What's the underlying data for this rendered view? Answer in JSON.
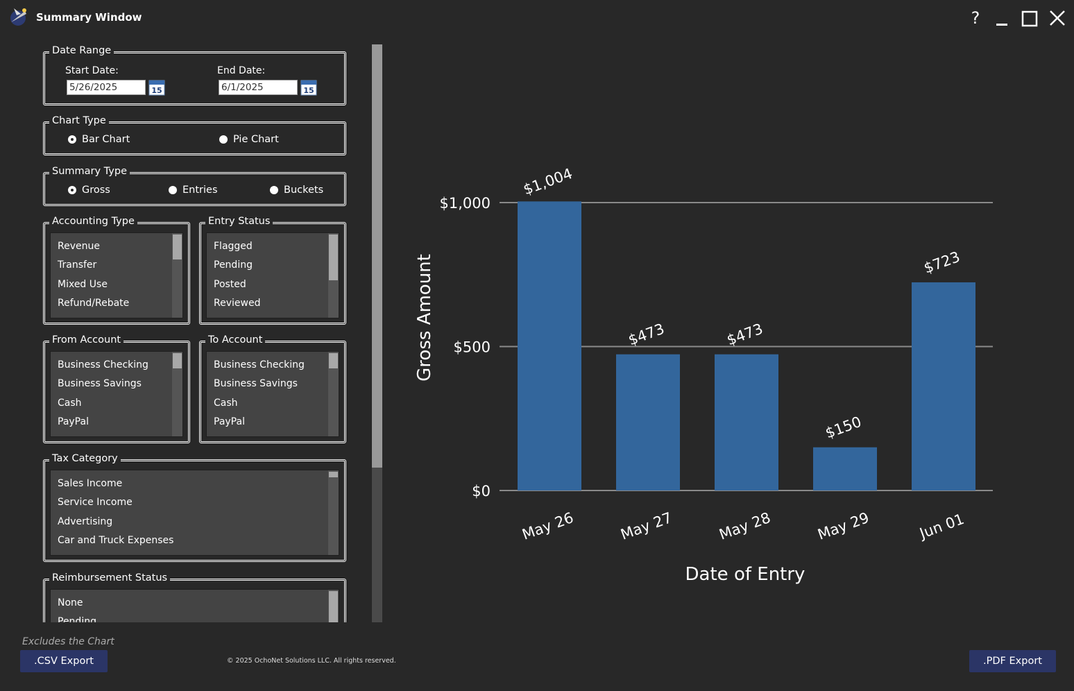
{
  "window": {
    "title": "Summary Window",
    "help_label": "?"
  },
  "date_range": {
    "legend": "Date Range",
    "start_label": "Start Date:",
    "start_value": "5/26/2025",
    "end_label": "End Date:",
    "end_value": "6/1/2025",
    "calendar_day": "15"
  },
  "chart_type": {
    "legend": "Chart Type",
    "options": [
      "Bar Chart",
      "Pie Chart"
    ],
    "selected": "Bar Chart"
  },
  "summary_type": {
    "legend": "Summary Type",
    "options": [
      "Gross",
      "Entries",
      "Buckets"
    ],
    "selected": "Gross"
  },
  "accounting_type": {
    "legend": "Accounting Type",
    "items": [
      "Revenue",
      "Transfer",
      "Mixed Use",
      "Refund/Rebate"
    ]
  },
  "entry_status": {
    "legend": "Entry Status",
    "items": [
      "Flagged",
      "Pending",
      "Posted",
      "Reviewed"
    ]
  },
  "from_account": {
    "legend": "From Account",
    "items": [
      "Business Checking",
      "Business Savings",
      "Cash",
      "PayPal"
    ]
  },
  "to_account": {
    "legend": "To Account",
    "items": [
      "Business Checking",
      "Business Savings",
      "Cash",
      "PayPal"
    ]
  },
  "tax_category": {
    "legend": "Tax Category",
    "items": [
      "Sales Income",
      "Service Income",
      "Advertising",
      "Car and Truck Expenses"
    ]
  },
  "reimbursement_status": {
    "legend": "Reimbursement Status",
    "items": [
      "None",
      "Pending"
    ]
  },
  "footer": {
    "note": "Excludes the Chart",
    "csv_label": ".CSV Export",
    "pdf_label": ".PDF Export",
    "copyright": "© 2025 OchoNet Solutions LLC. All rights reserved."
  },
  "colors": {
    "background": "#282828",
    "bar": "#33669c",
    "button": "#2b3566"
  },
  "chart_data": {
    "type": "bar",
    "categories": [
      "May 26",
      "May 27",
      "May 28",
      "May 29",
      "Jun 01"
    ],
    "values": [
      1004,
      473,
      473,
      150,
      723
    ],
    "data_labels": [
      "$1,004",
      "$473",
      "$473",
      "$150",
      "$723"
    ],
    "xlabel": "Date of Entry",
    "ylabel": "Gross Amount",
    "yticks": [
      0,
      500,
      1000
    ],
    "ytick_labels": [
      "$0",
      "$500",
      "$1,000"
    ],
    "ylim": [
      0,
      1000
    ],
    "grid": true
  }
}
